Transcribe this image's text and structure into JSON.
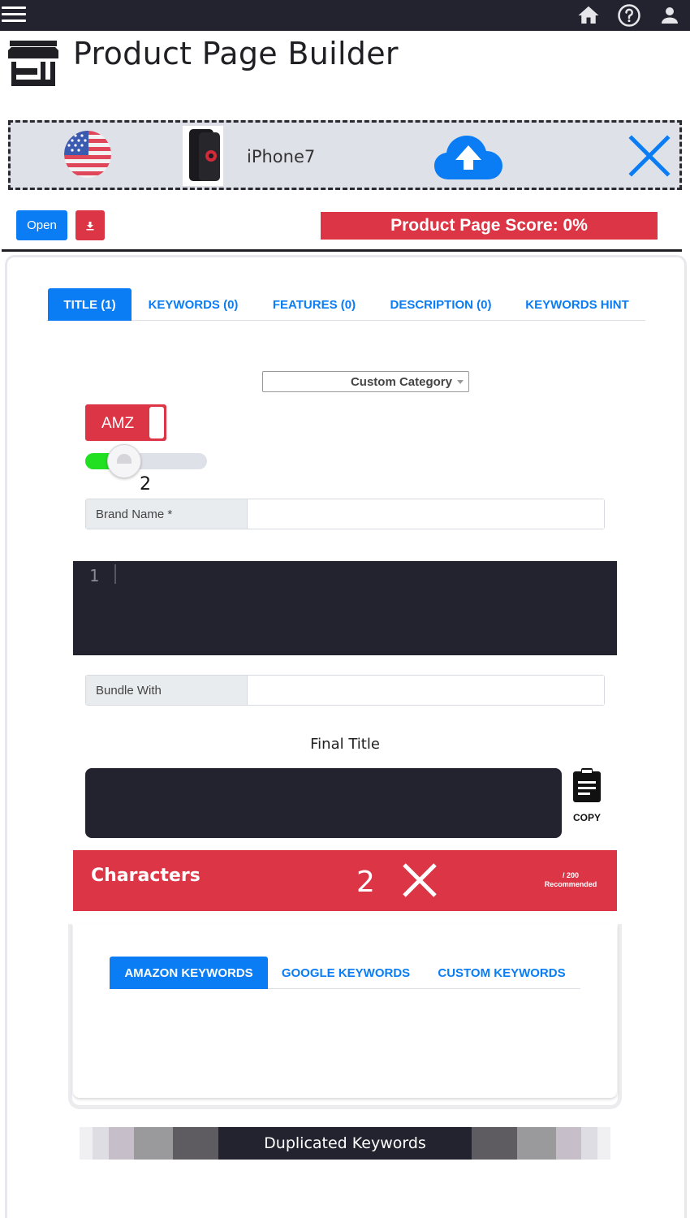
{
  "header": {
    "menu_icon": "hamburger-icon",
    "icons": [
      "home-icon",
      "help-icon",
      "user-icon"
    ]
  },
  "page": {
    "title": "Product Page Builder",
    "icon": "store-icon"
  },
  "product_bar": {
    "flag_icon": "us-flag-icon",
    "product_name": "iPhone7",
    "upload_icon": "cloud-upload-icon",
    "close_icon": "close-icon"
  },
  "actions": {
    "open_label": "Open",
    "download_icon": "download-icon",
    "score_text": "Product Page Score: 0%"
  },
  "tabs": [
    {
      "label": "TITLE (1)",
      "active": true
    },
    {
      "label": "KEYWORDS (0)",
      "active": false
    },
    {
      "label": "FEATURES (0)",
      "active": false
    },
    {
      "label": "DESCRIPTION (0)",
      "active": false
    },
    {
      "label": "KEYWORDS HINT",
      "active": false
    }
  ],
  "title_tab": {
    "category_select": "Custom Category",
    "toggle_label": "AMZ",
    "slider_value": "2",
    "brand_name_label": "Brand Name *",
    "brand_name_value": "",
    "editor_line_number": "1",
    "bundle_with_label": "Bundle With",
    "bundle_with_value": "",
    "final_title_label": "Final Title",
    "final_title_value": "",
    "copy_label": "COPY",
    "copy_icon": "clipboard-icon"
  },
  "characters": {
    "label": "Characters",
    "count": "2",
    "status_icon": "x-icon",
    "limit_line1": "/ 200",
    "limit_line2": "Recommended"
  },
  "keyword_tabs": [
    {
      "label": "AMAZON KEYWORDS",
      "active": true
    },
    {
      "label": "GOOGLE KEYWORDS",
      "active": false
    },
    {
      "label": "CUSTOM KEYWORDS",
      "active": false
    }
  ],
  "duplicated": {
    "label": "Duplicated Keywords"
  },
  "colors": {
    "accent_blue": "#0a7df5",
    "danger_red": "#dc3545",
    "dark": "#232330",
    "slider_green": "#20e020",
    "bar_gray": "#dfe1e8"
  }
}
